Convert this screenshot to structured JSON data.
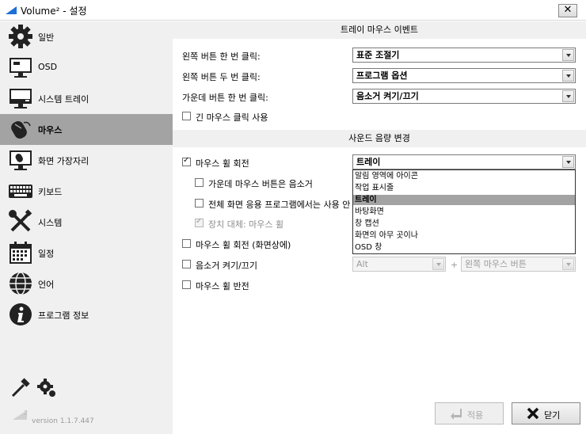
{
  "window": {
    "title": "Volume² - 설정",
    "close_glyph": "✕"
  },
  "sidebar": {
    "items": [
      {
        "label": "일반",
        "icon": "gear-icon"
      },
      {
        "label": "OSD",
        "icon": "monitor-icon"
      },
      {
        "label": "시스템 트레이",
        "icon": "system-tray-icon"
      },
      {
        "label": "마우스",
        "icon": "mouse-icon",
        "selected": true
      },
      {
        "label": "화면 가장자리",
        "icon": "screen-edge-icon"
      },
      {
        "label": "키보드",
        "icon": "keyboard-icon"
      },
      {
        "label": "시스템",
        "icon": "tools-icon"
      },
      {
        "label": "일정",
        "icon": "calendar-icon"
      },
      {
        "label": "언어",
        "icon": "globe-icon"
      },
      {
        "label": "프로그램 정보",
        "icon": "info-icon"
      }
    ],
    "bottom_tools": [
      "wrench-icon",
      "settings-gears-icon"
    ],
    "version": "version 1.1.7.447",
    "version_logo_text": "2"
  },
  "tray_events": {
    "header": "트레이 마우스 이벤트",
    "rows": [
      {
        "label": "왼쪽 버튼 한 번 클릭:",
        "value": "표준 조절기"
      },
      {
        "label": "왼쪽 버튼 두 번 클릭:",
        "value": "프로그램 옵션"
      },
      {
        "label": "가운데 버튼 한 번 클릭:",
        "value": "음소거 켜기/끄기"
      }
    ],
    "long_click": {
      "label": "긴 마우스 클릭 사용",
      "checked": false
    }
  },
  "volume_change": {
    "header": "사운드 음량 변경",
    "wheel_rotation": {
      "label": "마우스 휠 회전",
      "checked": true,
      "value": "트레이"
    },
    "middle_mute": {
      "label": "가운데 마우스 버튼은 음소거",
      "checked": false
    },
    "fullscreen": {
      "label": "전체 화면 응용 프로그램에서는 사용 안 함",
      "checked": false
    },
    "device_replace": {
      "label": "장치 대체: 마우스 휠",
      "checked": true,
      "disabled": true
    },
    "wheel_on_screen": {
      "label": "마우스 휠 회전 (화면상에)",
      "checked": false
    },
    "mute_toggle": {
      "label": "음소거 켜기/끄기",
      "checked": false,
      "key": "Alt",
      "plus": "+",
      "button": "왼쪽 마우스 버튼"
    },
    "wheel_invert": {
      "label": "마우스 휠 반전",
      "checked": false
    }
  },
  "dropdown": {
    "options": [
      "알림 영역에 아이콘",
      "작업 표시줄",
      "트레이",
      "바탕화면",
      "창 캡션",
      "화면의 아무 곳이나",
      "OSD 창"
    ],
    "selected_index": 2
  },
  "buttons": {
    "apply": "적용",
    "close": "닫기"
  },
  "colors": {
    "selected_nav": "#a3a3a3",
    "sidebar_bg": "#f0f0f0",
    "logo_blue": "#1e6fd6"
  }
}
